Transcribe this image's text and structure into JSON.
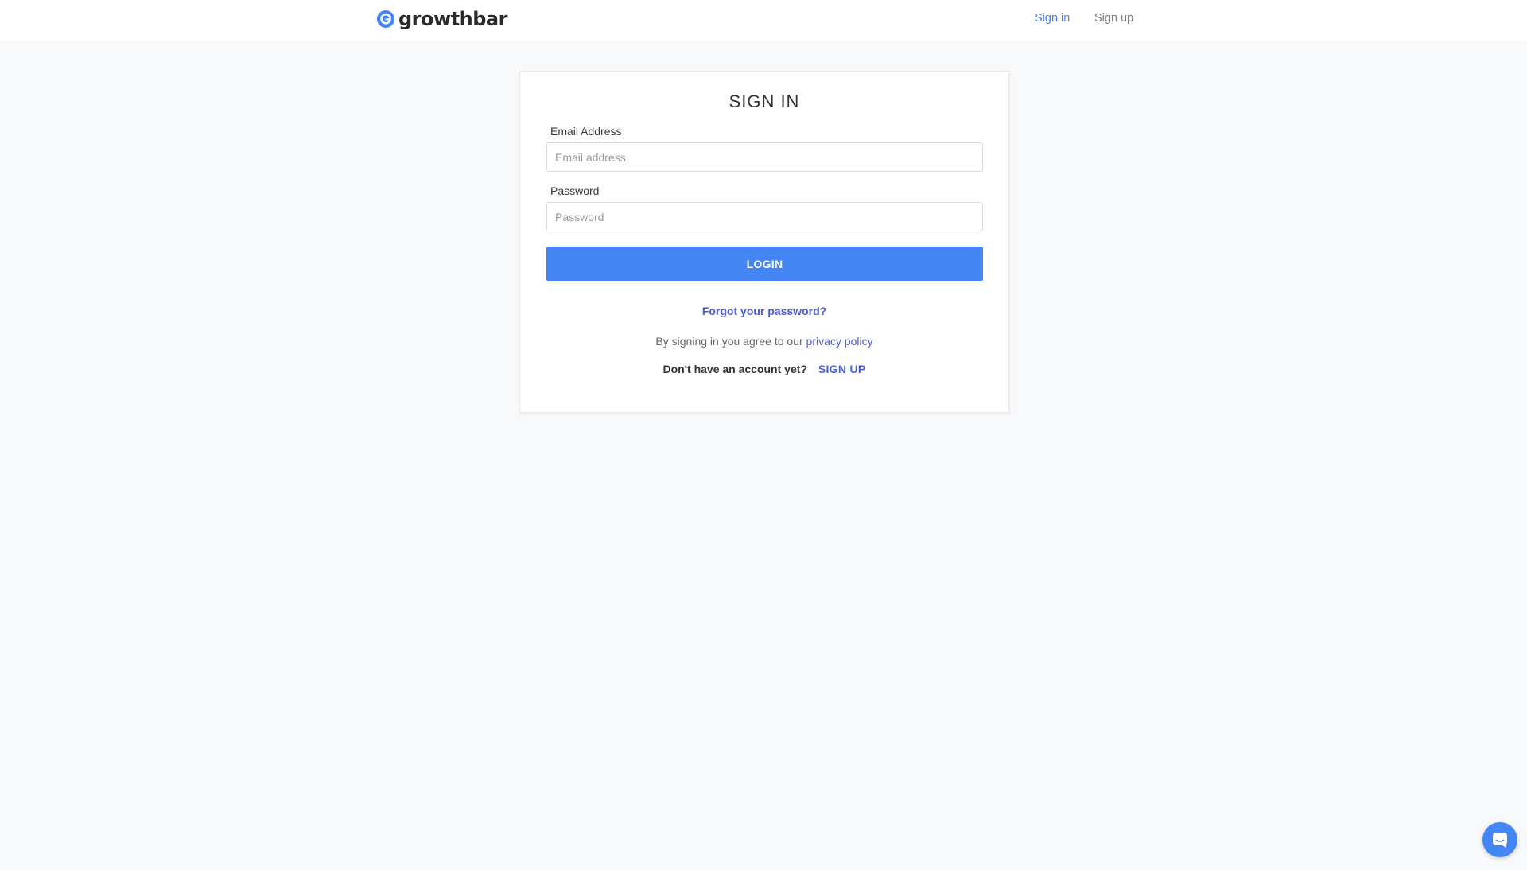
{
  "header": {
    "brand": "growthbar",
    "nav": {
      "sign_in": "Sign in",
      "sign_up": "Sign up"
    }
  },
  "form": {
    "title": "SIGN IN",
    "email": {
      "label": "Email Address",
      "placeholder": "Email address",
      "value": ""
    },
    "password": {
      "label": "Password",
      "placeholder": "Password",
      "value": ""
    },
    "login_label": "LOGIN",
    "forgot_link": "Forgot your password?",
    "agree_text": "By signing in you agree to our",
    "privacy_link": "privacy policy",
    "no_account_text": "Don't have an account yet?",
    "signup_link": "SIGN UP"
  },
  "icons": {
    "logo": "growthbar-logo-icon",
    "chat": "chat-icon"
  },
  "colors": {
    "accent": "#4386f4",
    "link": "#4a5bd6",
    "nav_active": "#4a7ce8",
    "background": "#f8f9fb"
  }
}
